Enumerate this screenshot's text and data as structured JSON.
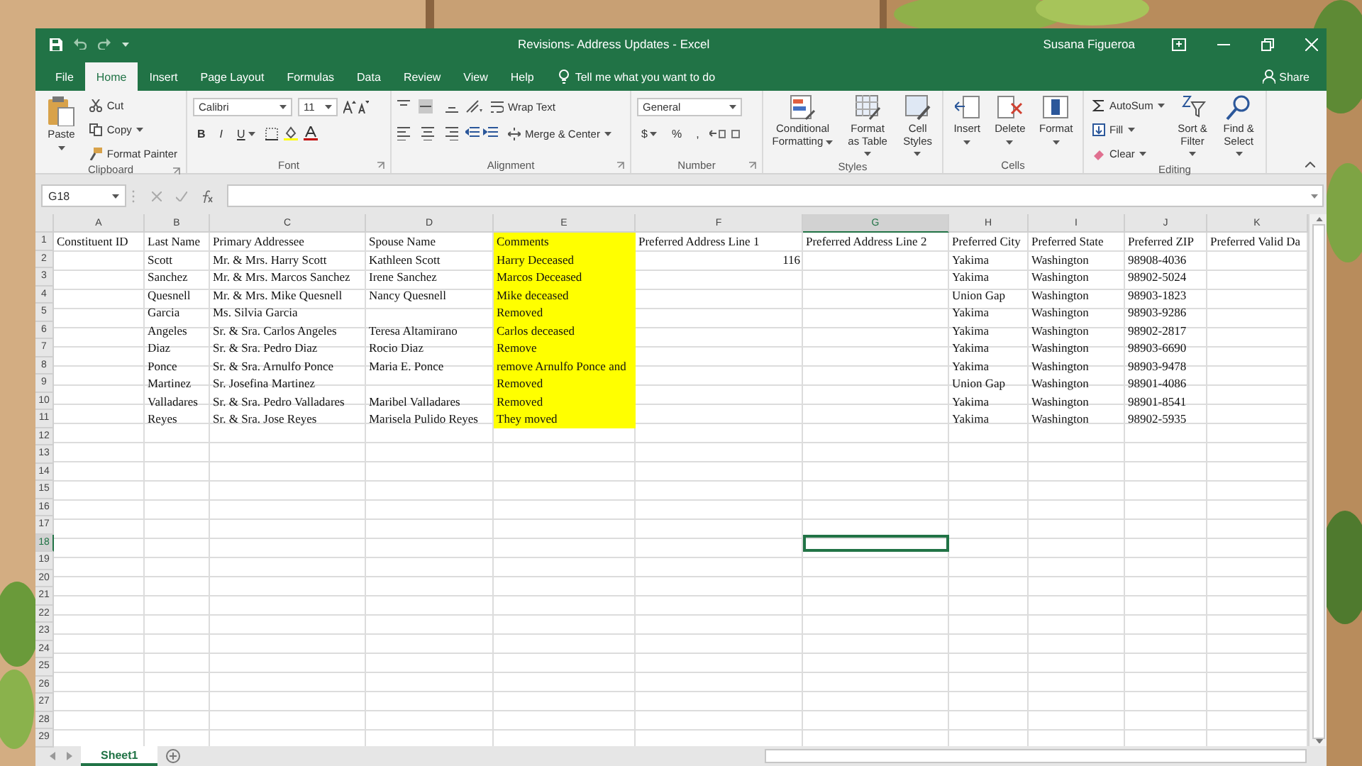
{
  "window": {
    "title": "Revisions- Address Updates - Excel",
    "user": "Susana Figueroa"
  },
  "menu_tabs": [
    {
      "label": "File",
      "selected": false
    },
    {
      "label": "Home",
      "selected": true
    },
    {
      "label": "Insert",
      "selected": false
    },
    {
      "label": "Page Layout",
      "selected": false
    },
    {
      "label": "Formulas",
      "selected": false
    },
    {
      "label": "Data",
      "selected": false
    },
    {
      "label": "Review",
      "selected": false
    },
    {
      "label": "View",
      "selected": false
    },
    {
      "label": "Help",
      "selected": false
    }
  ],
  "tell_me": "Tell me what you want to do",
  "share": "Share",
  "ribbon": {
    "groups": [
      {
        "kind": "clipboard",
        "label": "Clipboard",
        "paste": "Paste",
        "items": [
          "Cut",
          "Copy",
          "Format Painter"
        ]
      },
      {
        "kind": "font",
        "label": "Font",
        "font_name": "Calibri",
        "font_size": "11",
        "styles": [
          "B",
          "I",
          "U"
        ]
      },
      {
        "kind": "alignment",
        "label": "Alignment",
        "wrap": "Wrap Text",
        "merge": "Merge & Center"
      },
      {
        "kind": "number",
        "label": "Number",
        "format": "General",
        "symbols": [
          "$",
          "%",
          ","
        ]
      },
      {
        "kind": "styles",
        "label": "Styles",
        "buttons": [
          "Conditional Formatting",
          "Format as Table",
          "Cell Styles"
        ]
      },
      {
        "kind": "cells",
        "label": "Cells",
        "buttons": [
          "Insert",
          "Delete",
          "Format"
        ]
      },
      {
        "kind": "editing",
        "label": "Editing",
        "items": [
          "AutoSum",
          "Fill",
          "Clear"
        ],
        "buttons": [
          "Sort & Filter",
          "Find & Select"
        ]
      }
    ]
  },
  "formula_bar": {
    "name_box": "G18"
  },
  "sheet": {
    "columns": [
      {
        "letter": "A",
        "selected": false,
        "filled": false
      },
      {
        "letter": "B",
        "selected": false,
        "filled": false
      },
      {
        "letter": "C",
        "selected": false,
        "filled": false
      },
      {
        "letter": "D",
        "selected": false,
        "filled": false
      },
      {
        "letter": "E",
        "selected": false,
        "filled": true
      },
      {
        "letter": "F",
        "selected": false,
        "filled": false
      },
      {
        "letter": "G",
        "selected": true,
        "filled": false
      },
      {
        "letter": "H",
        "selected": false,
        "filled": false
      },
      {
        "letter": "I",
        "selected": false,
        "filled": false
      },
      {
        "letter": "J",
        "selected": false,
        "filled": false
      },
      {
        "letter": "K",
        "selected": false,
        "filled": false
      }
    ],
    "rows": [
      {
        "number": "1",
        "selected": false,
        "cells": [
          "Constituent ID",
          "Last Name",
          "Primary Addressee",
          "Spouse Name",
          "Comments",
          "Preferred Address Line 1",
          "Preferred Address Line 2",
          "Preferred City",
          "Preferred State",
          "Preferred ZIP",
          "Preferred Valid Da"
        ]
      },
      {
        "number": "2",
        "selected": false,
        "cells": [
          null,
          "Scott",
          "Mr. & Mrs. Harry Scott",
          "Kathleen Scott",
          "Harry Deceased",
          {
            "text": "116",
            "kind": "number"
          },
          null,
          "Yakima",
          "Washington",
          "98908-4036",
          null
        ]
      },
      {
        "number": "3",
        "selected": false,
        "cells": [
          null,
          "Sanchez",
          "Mr. & Mrs. Marcos Sanchez",
          "Irene Sanchez",
          "Marcos Deceased",
          null,
          null,
          "Yakima",
          "Washington",
          "98902-5024",
          null
        ]
      },
      {
        "number": "4",
        "selected": false,
        "cells": [
          null,
          "Quesnell",
          "Mr. & Mrs. Mike Quesnell",
          "Nancy Quesnell",
          "Mike deceased",
          null,
          null,
          "Union Gap",
          "Washington",
          "98903-1823",
          null
        ]
      },
      {
        "number": "5",
        "selected": false,
        "cells": [
          null,
          "Garcia",
          "Ms. Silvia Garcia",
          null,
          "Removed",
          null,
          null,
          "Yakima",
          "Washington",
          "98903-9286",
          null
        ]
      },
      {
        "number": "6",
        "selected": false,
        "cells": [
          null,
          "Angeles",
          "Sr. & Sra. Carlos Angeles",
          "Teresa Altamirano",
          "Carlos deceased",
          null,
          null,
          "Yakima",
          "Washington",
          "98902-2817",
          null
        ]
      },
      {
        "number": "7",
        "selected": false,
        "cells": [
          null,
          "Diaz",
          "Sr. & Sra. Pedro Diaz",
          "Rocio Diaz",
          "Remove",
          null,
          null,
          "Yakima",
          "Washington",
          "98903-6690",
          null
        ]
      },
      {
        "number": "8",
        "selected": false,
        "cells": [
          null,
          "Ponce",
          "Sr. & Sra. Arnulfo Ponce",
          "Maria E. Ponce",
          "remove Arnulfo Ponce and",
          null,
          null,
          "Yakima",
          "Washington",
          "98903-9478",
          null
        ]
      },
      {
        "number": "9",
        "selected": false,
        "cells": [
          null,
          "Martinez",
          "Sr. Josefina Martinez",
          null,
          "Removed",
          null,
          null,
          "Union Gap",
          "Washington",
          "98901-4086",
          null
        ]
      },
      {
        "number": "10",
        "selected": false,
        "cells": [
          null,
          "Valladares",
          "Sr. & Sra. Pedro Valladares",
          "Maribel Valladares",
          "Removed",
          null,
          null,
          "Yakima",
          "Washington",
          "98901-8541",
          null
        ]
      },
      {
        "number": "11",
        "selected": false,
        "cells": [
          null,
          "Reyes",
          "Sr. & Sra. Jose Reyes",
          "Marisela Pulido Reyes",
          "They moved",
          null,
          null,
          "Yakima",
          "Washington",
          "98902-5935",
          null
        ]
      },
      {
        "number": "12",
        "selected": false
      },
      {
        "number": "13",
        "selected": false
      },
      {
        "number": "14",
        "selected": false
      },
      {
        "number": "15",
        "selected": false
      },
      {
        "number": "16",
        "selected": false
      },
      {
        "number": "17",
        "selected": false
      },
      {
        "number": "18",
        "selected": true
      },
      {
        "number": "19",
        "selected": false
      },
      {
        "number": "20",
        "selected": false
      },
      {
        "number": "21",
        "selected": false
      },
      {
        "number": "22",
        "selected": false
      },
      {
        "number": "23",
        "selected": false
      },
      {
        "number": "24",
        "selected": false
      },
      {
        "number": "25",
        "selected": false
      },
      {
        "number": "26",
        "selected": false
      },
      {
        "number": "27",
        "selected": false
      },
      {
        "number": "28",
        "selected": false
      },
      {
        "number": "29",
        "selected": false
      }
    ]
  },
  "sheet_tabs": [
    {
      "label": "Sheet1",
      "selected": true
    }
  ]
}
